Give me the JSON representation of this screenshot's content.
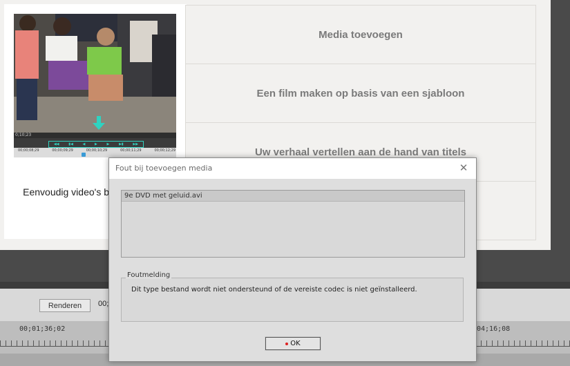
{
  "welcome": {
    "caption": "Eenvoudig video's b helpen u stap v",
    "actions": [
      {
        "label": "Media toevoegen"
      },
      {
        "label": "Een film maken op basis van een sjabloon"
      },
      {
        "label": "Uw verhaal vertellen aan de hand van titels"
      },
      {
        "label": ""
      }
    ],
    "preview": {
      "time_top": "0;10;23",
      "ruler_times": [
        "00;00;08;29",
        "00;00;09;29",
        "00;00;10;29",
        "00;00;11;29",
        "00;00;12;29"
      ],
      "transport_icons": [
        "skip-start",
        "prev",
        "step-back",
        "play",
        "step-fwd",
        "next",
        "skip-end"
      ]
    }
  },
  "bottom": {
    "render_button": "Renderen",
    "timecode_small": "00;",
    "timecode_left": "00;01;36;02",
    "timecode_right": "04;16;08"
  },
  "dialog": {
    "title": "Fout bij toevoegen media",
    "close_icon": "close-icon",
    "files": [
      "9e DVD met geluid.avi"
    ],
    "error_group_label": "Foutmelding",
    "error_message": "Dit type bestand wordt niet ondersteund of de vereiste codec is niet geïnstalleerd.",
    "ok_label": "OK"
  },
  "colors": {
    "accent_teal": "#2fd3c1",
    "dark_chrome": "#4a4a4a"
  }
}
